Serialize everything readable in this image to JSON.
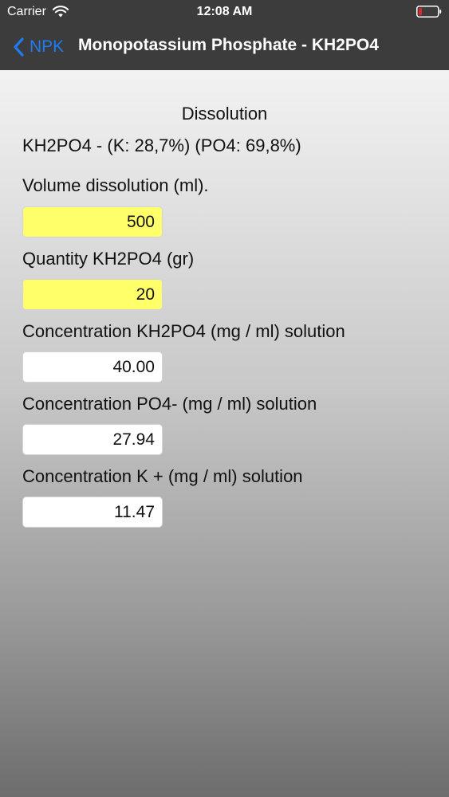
{
  "status_bar": {
    "carrier": "Carrier",
    "time": "12:08 AM",
    "battery_color": "#e0242a"
  },
  "nav": {
    "back_label": "NPK",
    "title": "Monopotassium Phosphate - KH2PO4",
    "accent_color": "#1f7cf0"
  },
  "form": {
    "heading": "Dissolution",
    "formula": "KH2PO4 - (K: 28,7%) (PO4: 69,8%)",
    "volume": {
      "label": "Volume dissolution (ml).",
      "value": "500"
    },
    "quantity": {
      "label": "Quantity KH2PO4 (gr)",
      "value": "20"
    },
    "conc_kh2po4": {
      "label": "Concentration KH2PO4 (mg / ml) solution",
      "value": "40.00"
    },
    "conc_po4": {
      "label": "Concentration PO4- (mg / ml) solution",
      "value": "27.94"
    },
    "conc_k": {
      "label": "Concentration K + (mg / ml) solution",
      "value": "11.47"
    },
    "input_highlight_color": "#ffff6a"
  }
}
